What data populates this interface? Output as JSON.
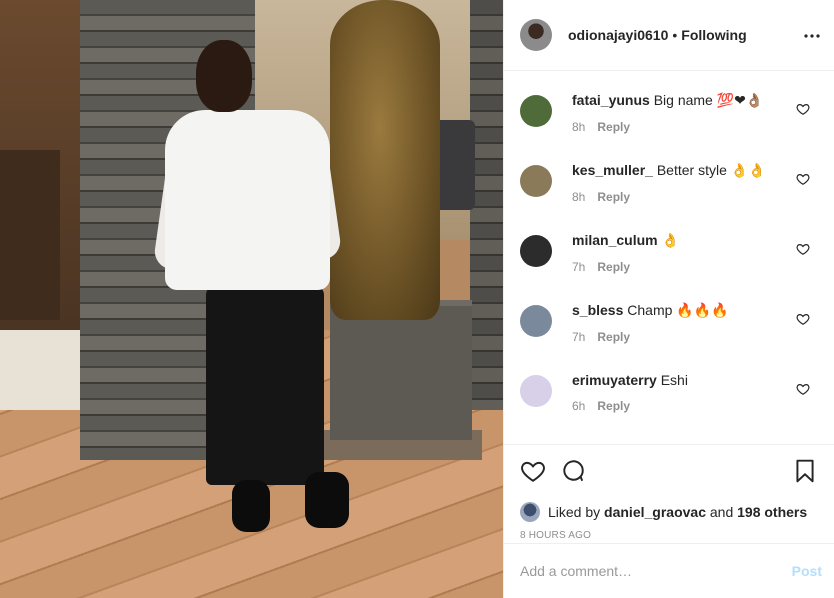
{
  "header": {
    "username": "odionajayi0610",
    "separator": "•",
    "follow_status": "Following"
  },
  "comments": [
    {
      "username": "fatai_yunus",
      "text": "Big name 💯❤👌🏽",
      "time": "8h",
      "reply": "Reply",
      "avatar_color": "#4f6b3a"
    },
    {
      "username": "kes_muller_",
      "text": "Better style 👌👌",
      "time": "8h",
      "reply": "Reply",
      "avatar_color": "#8a7a5a"
    },
    {
      "username": "milan_culum",
      "text": "👌",
      "time": "7h",
      "reply": "Reply",
      "avatar_color": "#2c2c2c"
    },
    {
      "username": "s_bless",
      "text": "Champ 🔥🔥🔥",
      "time": "7h",
      "reply": "Reply",
      "avatar_color": "#7a8a9c"
    },
    {
      "username": "erimuyaterry",
      "text": "Eshi",
      "time": "6h",
      "reply": "Reply",
      "avatar_color": "#d7d0e8"
    }
  ],
  "likes": {
    "prefix": "Liked by",
    "user": "daniel_graovac",
    "middle": "and",
    "others": "198 others"
  },
  "timestamp": "8 HOURS AGO",
  "add_comment": {
    "placeholder": "Add a comment…",
    "post_label": "Post"
  },
  "icons": [
    "more-icon",
    "heart-icon",
    "comment-icon",
    "bookmark-icon"
  ]
}
